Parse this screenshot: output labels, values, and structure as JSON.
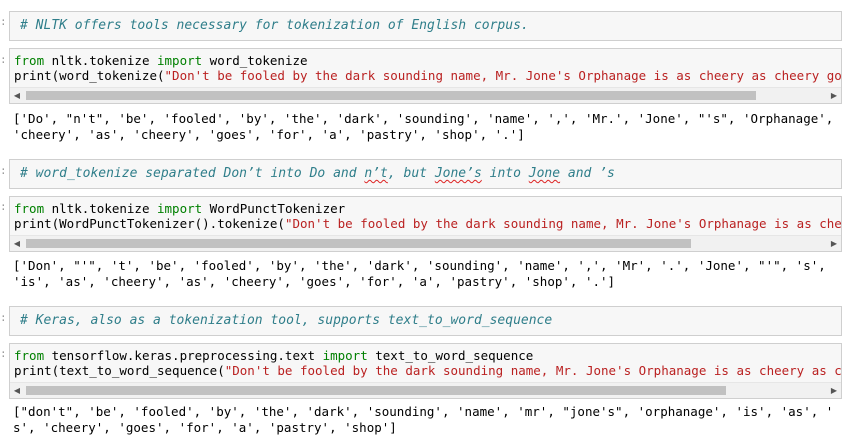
{
  "cells": [
    {
      "type": "markdown",
      "text": "# NLTK offers tools necessary for tokenization of English corpus."
    },
    {
      "type": "code",
      "line1_kw1": "from",
      "line1_mod": " nltk.tokenize ",
      "line1_kw2": "import",
      "line1_name": " word_tokenize",
      "line2_pre": "print(word_tokenize(",
      "line2_str": "\"Don't be fooled by the dark sounding name, Mr. Jone's Orphanage is as cheery as cheery goes for a past",
      "output_line1": "['Do', \"n't\", 'be', 'fooled', 'by', 'the', 'dark', 'sounding', 'name', ',', 'Mr.', 'Jone', \"'s\", 'Orphanage', 'is', 'as',",
      "output_line2": "'cheery', 'as', 'cheery', 'goes', 'for', 'a', 'pastry', 'shop', '.']"
    },
    {
      "type": "markdown",
      "text_a": "# word_tokenize separated Don’t into Do and ",
      "text_b": "n’t",
      "text_c": ", but ",
      "text_d": "Jone’s",
      "text_e": " into ",
      "text_f": "Jone",
      "text_g": " and ’s"
    },
    {
      "type": "code",
      "line1_kw1": "from",
      "line1_mod": " nltk.tokenize ",
      "line1_kw2": "import",
      "line1_name": " WordPunctTokenizer",
      "line2_pre": "print(WordPunctTokenizer().tokenize(",
      "line2_str": "\"Don't be fooled by the dark sounding name, Mr. Jone's Orphanage is as cheery as cheery",
      "output_line1": "['Don', \"'\", 't', 'be', 'fooled', 'by', 'the', 'dark', 'sounding', 'name', ',', 'Mr', '.', 'Jone', \"'\", 's', 'Orphanage',",
      "output_line2": "'is', 'as', 'cheery', 'as', 'cheery', 'goes', 'for', 'a', 'pastry', 'shop', '.']"
    },
    {
      "type": "markdown",
      "text": "# Keras, also as a tokenization tool, supports text_to_word_sequence"
    },
    {
      "type": "code",
      "line1_kw1": "from",
      "line1_mod": " tensorflow.keras.preprocessing.text ",
      "line1_kw2": "import",
      "line1_name": " text_to_word_sequence",
      "line2_pre": "print(text_to_word_sequence(",
      "line2_str": "\"Don't be fooled by the dark sounding name, Mr. Jone's Orphanage is as cheery as cheery goes fo",
      "output_line1": "[\"don't\", 'be', 'fooled', 'by', 'the', 'dark', 'sounding', 'name', 'mr', \"jone's\", 'orphanage', 'is', 'as', 'cheery', 'a",
      "output_line2": "s', 'cheery', 'goes', 'for', 'a', 'pastry', 'shop']"
    }
  ],
  "scroll_fractions": [
    0.89,
    0.81,
    0.86
  ],
  "icons": {
    "left": "scroll-left-arrow-icon",
    "right": "scroll-right-arrow-icon"
  }
}
